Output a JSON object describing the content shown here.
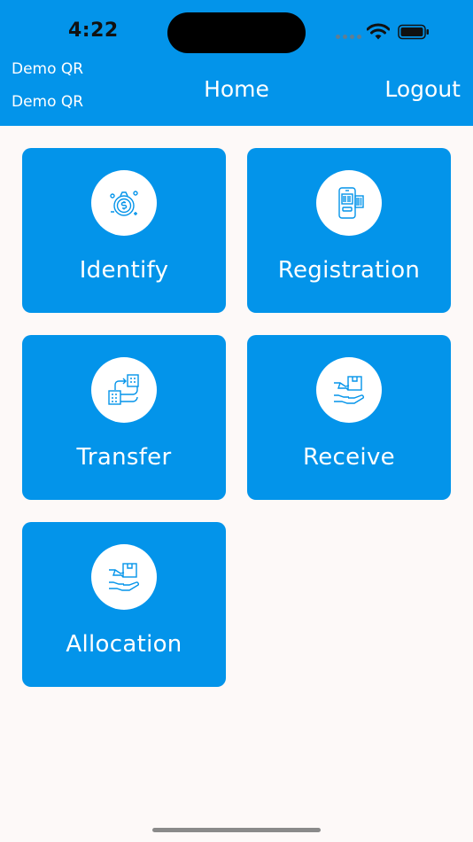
{
  "status_bar": {
    "time": "4:22"
  },
  "header": {
    "org_line_1": "Demo QR",
    "org_line_2": "Demo QR",
    "title": "Home",
    "logout_label": "Logout"
  },
  "tiles": [
    {
      "label": "Identify",
      "icon": "money-target-icon"
    },
    {
      "label": "Registration",
      "icon": "phone-barcode-icon"
    },
    {
      "label": "Transfer",
      "icon": "building-transfer-icon"
    },
    {
      "label": "Receive",
      "icon": "hand-box-icon"
    },
    {
      "label": "Allocation",
      "icon": "hand-box-icon"
    }
  ],
  "colors": {
    "primary": "#0394ea",
    "background": "#fdf9f8",
    "text_on_primary": "#ffffff"
  }
}
